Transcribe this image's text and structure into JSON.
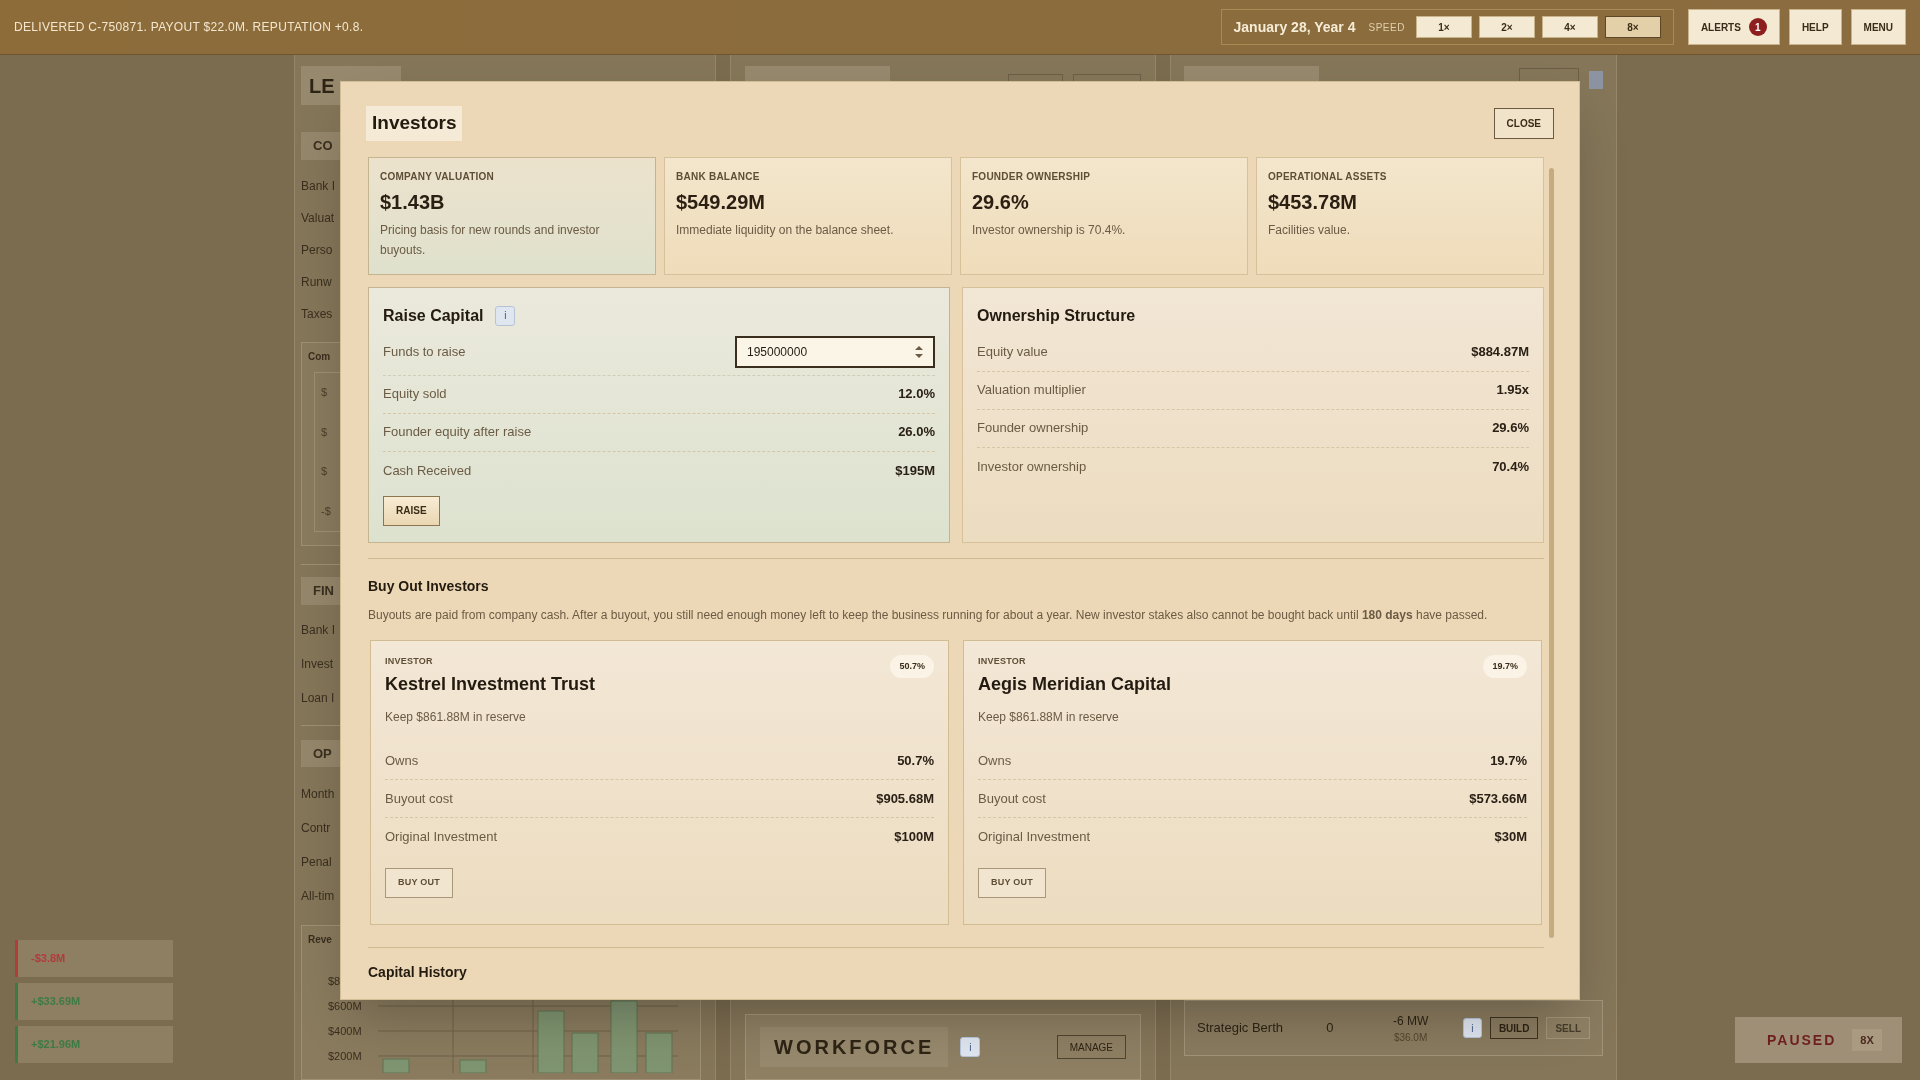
{
  "top_bar": {
    "message": "DELIVERED C-750871. PAYOUT $22.0M. REPUTATION +0.8.",
    "date": "January 28, Year 4",
    "speed_label": "SPEED",
    "speeds": [
      {
        "label": "1×",
        "selected": false
      },
      {
        "label": "2×",
        "selected": false
      },
      {
        "label": "4×",
        "selected": false
      },
      {
        "label": "8×",
        "selected": true
      }
    ],
    "alerts": {
      "label": "ALERTS",
      "count": "1"
    },
    "buttons": [
      "HELP",
      "MENU"
    ]
  },
  "ledger": {
    "title": "LE",
    "section_1": "CO",
    "rows_1": [
      "Bank I",
      "Valuat",
      "Perso",
      "Runw",
      "Taxes"
    ],
    "mini_chart": {
      "title": "Com",
      "ticks": [
        "$",
        "$",
        "$",
        "-$"
      ]
    },
    "section_2": "FIN",
    "rows_2": [
      "Bank I",
      "Invest",
      "Loan I"
    ],
    "section_3": "OP",
    "rows_3": [
      "Month",
      "Contr",
      "Penal",
      "All-tim"
    ],
    "revenue_chart": {
      "title": "Reve",
      "ticks": [
        "$8",
        "$600M",
        "$400M",
        "$200M"
      ]
    }
  },
  "workforce": {
    "title": "WORKFORCE",
    "info": "i",
    "button": "MANAGE"
  },
  "facility_row": {
    "name": "Strategic Berth",
    "count": "0",
    "power": "-6 MW",
    "cost": "$36.0M",
    "info": "i",
    "buttons": [
      {
        "label": "BUILD",
        "disabled": false
      },
      {
        "label": "SELL",
        "disabled": true
      }
    ]
  },
  "toasts": [
    {
      "text": "-$3.8M",
      "color": "#b23b3b"
    },
    {
      "text": "+$33.69M",
      "color": "#3f7a45"
    },
    {
      "text": "+$21.96M",
      "color": "#3f7a45"
    }
  ],
  "playback": {
    "state": "PAUSED",
    "speed": "8X"
  },
  "modal": {
    "title": "Investors",
    "close": "CLOSE",
    "stats": [
      {
        "label": "COMPANY VALUATION",
        "value": "$1.43B",
        "note": "Pricing basis for new rounds and investor buyouts.",
        "selected": true
      },
      {
        "label": "BANK BALANCE",
        "value": "$549.29M",
        "note": "Immediate liquidity on the balance sheet.",
        "selected": false
      },
      {
        "label": "FOUNDER OWNERSHIP",
        "value": "29.6%",
        "note": "Investor ownership is 70.4%.",
        "selected": false
      },
      {
        "label": "OPERATIONAL ASSETS",
        "value": "$453.78M",
        "note": "Facilities value.",
        "selected": false
      }
    ],
    "raise_capital": {
      "title": "Raise Capital",
      "info": "i",
      "funds_label": "Funds to raise",
      "funds_value": "195000000",
      "rows": [
        {
          "label": "Equity sold",
          "value": "12.0%"
        },
        {
          "label": "Founder equity after raise",
          "value": "26.0%"
        },
        {
          "label": "Cash Received",
          "value": "$195M"
        }
      ],
      "button": "RAISE"
    },
    "ownership": {
      "title": "Ownership Structure",
      "rows": [
        {
          "label": "Equity value",
          "value": "$884.87M"
        },
        {
          "label": "Valuation multiplier",
          "value": "1.95x"
        },
        {
          "label": "Founder ownership",
          "value": "29.6%"
        },
        {
          "label": "Investor ownership",
          "value": "70.4%"
        }
      ]
    },
    "buyout": {
      "title": "Buy Out Investors",
      "description": "Buyouts are paid from company cash. After a buyout, you still need enough money left to keep the business running for about a year. New investor stakes also cannot be bought back until **180 days** have passed.",
      "investors": [
        {
          "tag": "INVESTOR",
          "name": "Kestrel Investment Trust",
          "share": "50.7%",
          "reserve": "Keep $861.88M in reserve",
          "rows": [
            {
              "label": "Owns",
              "value": "50.7%"
            },
            {
              "label": "Buyout cost",
              "value": "$905.68M"
            },
            {
              "label": "Original Investment",
              "value": "$100M"
            }
          ],
          "button": "BUY OUT"
        },
        {
          "tag": "INVESTOR",
          "name": "Aegis Meridian Capital",
          "share": "19.7%",
          "reserve": "Keep $861.88M in reserve",
          "rows": [
            {
              "label": "Owns",
              "value": "19.7%"
            },
            {
              "label": "Buyout cost",
              "value": "$573.66M"
            },
            {
              "label": "Original Investment",
              "value": "$30M"
            }
          ],
          "button": "BUY OUT"
        }
      ]
    },
    "capital_history_title": "Capital History"
  }
}
